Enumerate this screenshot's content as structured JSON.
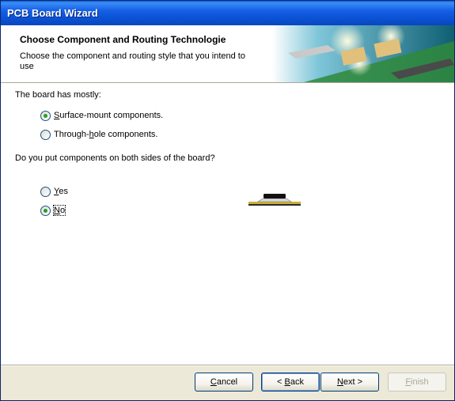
{
  "window": {
    "title": "PCB Board Wizard"
  },
  "header": {
    "title": "Choose Component and Routing Technologie",
    "subtitle": "Choose the component and routing style that you intend to use"
  },
  "component_question": {
    "label": "The board has mostly:",
    "options": [
      {
        "pre": "",
        "mn": "S",
        "post": "urface-mount components.",
        "selected": true
      },
      {
        "pre": "Through-",
        "mn": "h",
        "post": "ole components.",
        "selected": false
      }
    ]
  },
  "sides_question": {
    "label": "Do you put components on both sides of the board?",
    "options": [
      {
        "pre": "",
        "mn": "Y",
        "post": "es",
        "selected": false
      },
      {
        "pre": "",
        "mn": "N",
        "post": "o",
        "selected": true
      }
    ]
  },
  "buttons": {
    "cancel": {
      "mn": "C",
      "post": "ancel"
    },
    "back": {
      "pre": "< ",
      "mn": "B",
      "post": "ack"
    },
    "next": {
      "mn": "N",
      "post": "ext >"
    },
    "finish": {
      "mn": "F",
      "post": "inish"
    }
  },
  "colors": {
    "title_bar": "#0b52d4",
    "radio_dot": "#21a121",
    "board": "#c9b03a"
  }
}
